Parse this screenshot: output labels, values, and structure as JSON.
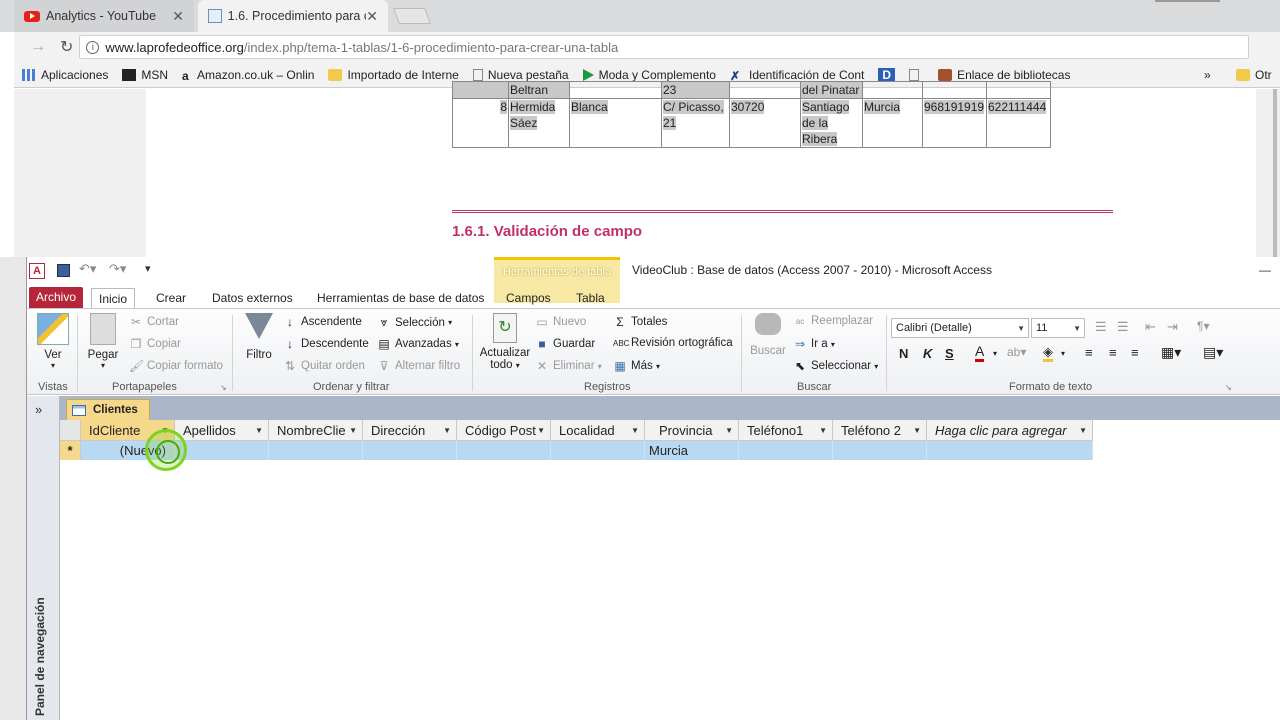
{
  "browser": {
    "tabs": [
      {
        "title": "Analytics - YouTube"
      },
      {
        "title": "1.6. Procedimiento para c"
      }
    ],
    "url_host": "www.laprofedeoffice.org",
    "url_path": "/index.php/tema-1-tablas/1-6-procedimiento-para-crear-una-tabla",
    "bookmarks": [
      "Aplicaciones",
      "MSN",
      "Amazon.co.uk – Onlin",
      "Importado de Interne",
      "Nueva pestaña",
      "Moda y Complemento",
      "Identificación de Cont",
      "D",
      "",
      "Enlace de bibliotecas"
    ],
    "bookmarks_more": "»",
    "bookmarks_other": "Otr"
  },
  "webpage": {
    "table_rows": [
      [
        "",
        "Beltran",
        "",
        "23",
        "",
        "del Pinatar",
        "",
        ""
      ],
      [
        "8",
        "Hermida Sáez",
        "Blanca",
        "C/ Picasso, 21",
        "30720",
        "Santiago de la Ribera",
        "Murcia",
        "968191919",
        "622111444"
      ]
    ],
    "section_heading": "1.6.1. Validación de campo"
  },
  "access": {
    "contextual_tools": "Herramientas de tabla",
    "title": "VideoClub : Base de datos (Access 2007 - 2010)  -  Microsoft Access",
    "ribbon_tabs": [
      "Archivo",
      "Inicio",
      "Crear",
      "Datos externos",
      "Herramientas de base de datos",
      "Campos",
      "Tabla"
    ],
    "groups": {
      "vistas": {
        "label": "Vistas",
        "ver": "Ver"
      },
      "portapapeles": {
        "label": "Portapapeles",
        "pegar": "Pegar",
        "cortar": "Cortar",
        "copiar": "Copiar",
        "copiar_formato": "Copiar formato"
      },
      "ordenar": {
        "label": "Ordenar y filtrar",
        "filtro": "Filtro",
        "ascendente": "Ascendente",
        "descendente": "Descendente",
        "quitar_orden": "Quitar orden",
        "seleccion": "Selección",
        "avanzadas": "Avanzadas",
        "alternar": "Alternar filtro"
      },
      "registros": {
        "label": "Registros",
        "actualizar": "Actualizar",
        "todo": "todo",
        "nuevo": "Nuevo",
        "guardar": "Guardar",
        "eliminar": "Eliminar",
        "totales": "Totales",
        "revision": "Revisión ortográfica",
        "mas": "Más"
      },
      "buscar": {
        "label": "Buscar",
        "buscar": "Buscar",
        "reemplazar": "Reemplazar",
        "ir_a": "Ir a",
        "seleccionar": "Seleccionar"
      },
      "formato": {
        "label": "Formato de texto",
        "font": "Calibri (Detalle)",
        "size": "11",
        "bold": "N",
        "italic": "K",
        "underline": "S"
      }
    },
    "nav_pane_label": "Panel de navegación",
    "nav_toggle": "»",
    "object_tab": "Clientes",
    "columns": [
      "IdCliente",
      "Apellidos",
      "NombreClie",
      "Dirección",
      "Código Post",
      "Localidad",
      "Provincia",
      "Teléfono1",
      "Teléfono 2",
      "Haga clic para agregar"
    ],
    "new_row": {
      "marker": "*",
      "idcliente": "(Nuevo)",
      "provincia": "Murcia"
    }
  }
}
